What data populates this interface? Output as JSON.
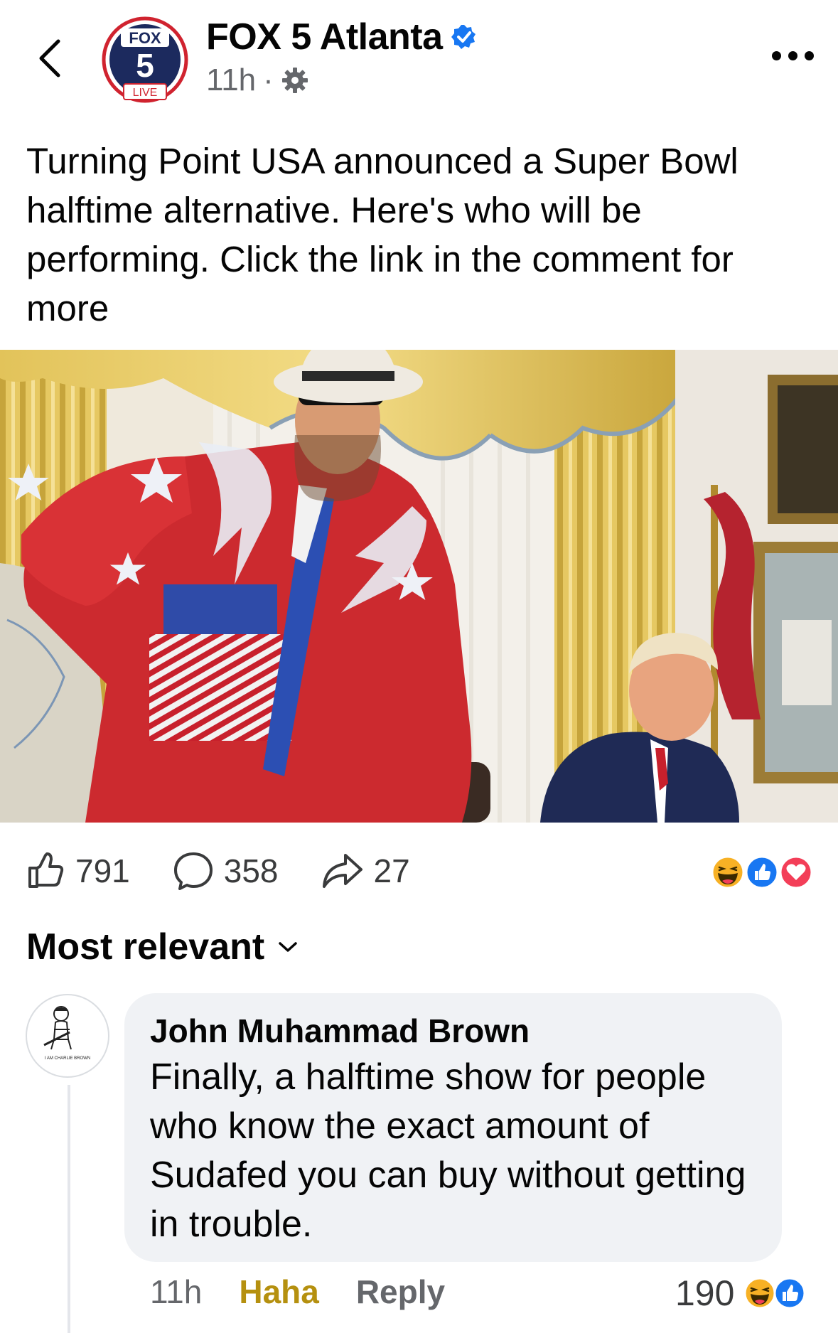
{
  "header": {
    "page_name": "FOX 5 Atlanta",
    "time": "11h",
    "separator": "·",
    "logo_top": "FOX",
    "logo_number": "5",
    "logo_live": "LIVE"
  },
  "post": {
    "caption": "Turning Point USA announced a Super Bowl halftime alternative. Here's who will be performing. Click the link in the comment for more"
  },
  "actions": {
    "likes": "791",
    "comments": "358",
    "shares": "27",
    "reaction_icons": [
      "haha-icon",
      "like-icon",
      "love-icon"
    ]
  },
  "comments_section": {
    "sort_label": "Most relevant"
  },
  "comment": {
    "author": "John Muhammad Brown",
    "text": "Finally, a halftime show for people who know the exact amount of Sudafed you can buy without getting in trouble.",
    "time": "11h",
    "reaction_label": "Haha",
    "reply_label": "Reply",
    "reaction_count": "190",
    "avatar_caption": "I AM CHARLIE BROWN"
  },
  "colors": {
    "accent_blue": "#1877f2",
    "love_red": "#f33e58",
    "haha_yellow": "#f7b125",
    "haha_text": "#b5900f",
    "fox_red": "#d0232f",
    "fox_navy": "#1c2a5e"
  }
}
